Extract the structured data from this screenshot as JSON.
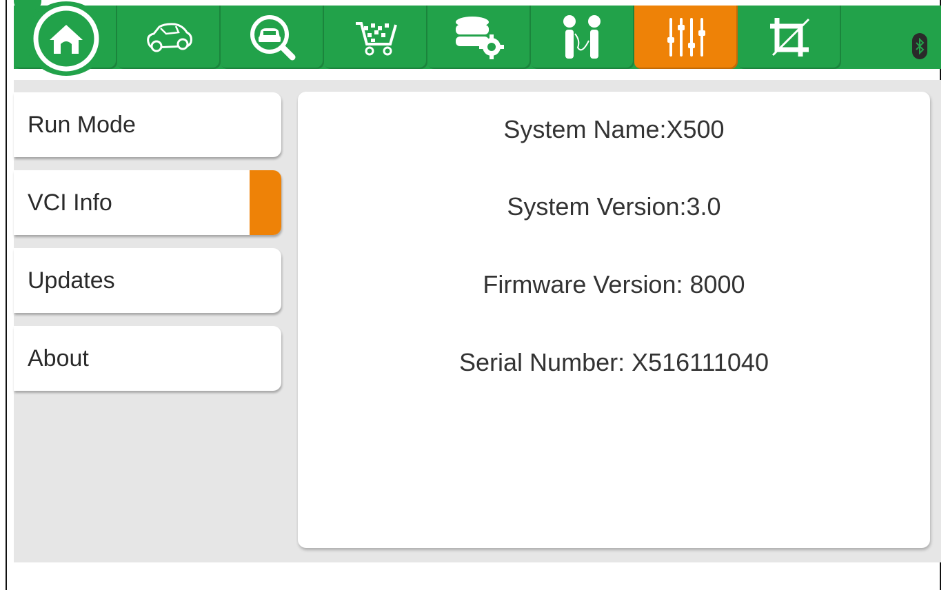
{
  "toolbar": {
    "tabs": [
      {
        "icon": "home-icon"
      },
      {
        "icon": "car-icon"
      },
      {
        "icon": "car-search-icon"
      },
      {
        "icon": "shopping-cart-icon"
      },
      {
        "icon": "database-settings-icon"
      },
      {
        "icon": "people-talk-icon"
      },
      {
        "icon": "settings-sliders-icon",
        "active": true
      },
      {
        "icon": "crop-icon"
      }
    ],
    "bluetooth_icon": "bluetooth-icon",
    "accent": "#22a24a",
    "active_color": "#ee8207"
  },
  "sidebar": {
    "items": [
      {
        "label": "Run Mode"
      },
      {
        "label": "VCI Info",
        "selected": true
      },
      {
        "label": "Updates"
      },
      {
        "label": "About"
      }
    ]
  },
  "info": {
    "system_name": "System Name:X500",
    "system_version": "System Version:3.0",
    "firmware_version": "Firmware Version:  8000",
    "serial_number": "Serial Number:  X516111040"
  }
}
